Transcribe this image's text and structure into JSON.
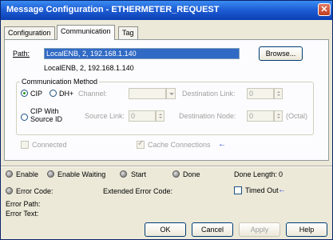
{
  "window": {
    "title": "Message Configuration - ETHERMETER_REQUEST",
    "close_glyph": "✕"
  },
  "tabs": [
    "Configuration",
    "Communication",
    "Tag"
  ],
  "path": {
    "label": "Path:",
    "value": "LocalENB, 2, 192.168.1.140",
    "resolved": "LocalENB, 2, 192.168.1.140",
    "browse_label": "Browse..."
  },
  "comm_method": {
    "title": "Communication Method",
    "cip_label": "CIP",
    "dhplus_label": "DH+",
    "cip_source_line1": "CIP With",
    "cip_source_line2": "Source ID",
    "channel_label": "Channel:",
    "dest_link_label": "Destination Link:",
    "dest_link_value": "0",
    "source_link_label": "Source Link:",
    "source_link_value": "0",
    "dest_node_label": "Destination Node:",
    "dest_node_value": "0",
    "octal_label": "(Octal)"
  },
  "options": {
    "connected_label": "Connected",
    "cache_label": "Cache Connections",
    "cache_checked": true
  },
  "status": {
    "enable_label": "Enable",
    "enable_waiting_label": "Enable Waiting",
    "start_label": "Start",
    "done_label": "Done",
    "done_length_label": "Done Length:",
    "done_length_value": "0",
    "error_code_label": "Error Code:",
    "ext_error_code_label": "Extended Error Code:",
    "timed_out_label": "Timed Out",
    "error_path_label": "Error Path:",
    "error_text_label": "Error Text:"
  },
  "buttons": {
    "ok": "OK",
    "cancel": "Cancel",
    "apply": "Apply",
    "help": "Help"
  },
  "colors": {
    "title_bar": "#1f5fd6",
    "selection": "#316ac5",
    "arrow": "#1f39d9"
  }
}
